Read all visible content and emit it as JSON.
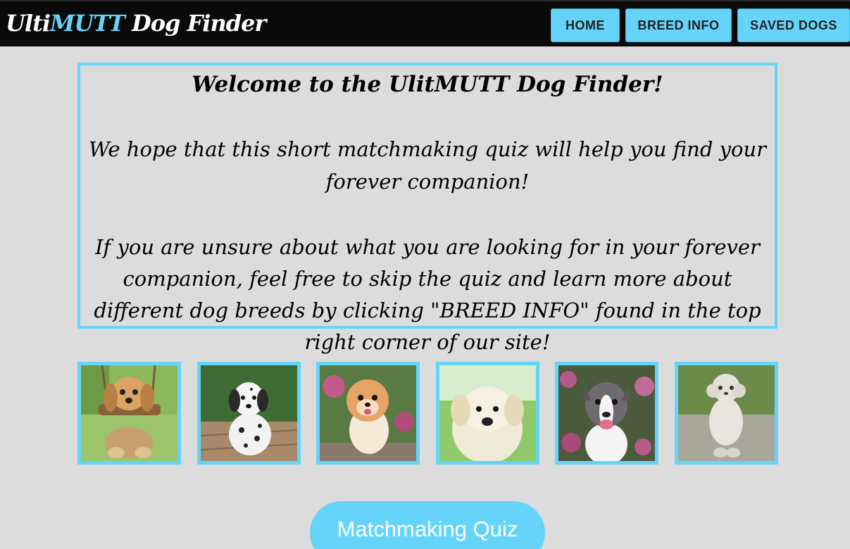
{
  "header": {
    "brand_prefix": "Ulti",
    "brand_accent": "MUTT",
    "brand_suffix": " Dog Finder",
    "nav": {
      "home": "HOME",
      "breed_info": "BREED INFO",
      "saved_dogs": "SAVED DOGS"
    }
  },
  "welcome": {
    "title": "Welcome to the UlitMUTT Dog Finder!",
    "paragraph_1": "We hope that this short matchmaking quiz will help you find your forever companion!",
    "paragraph_2": "If you are unsure about what you are looking for in your forever companion, feel free to skip the quiz and learn more about different dog breeds by clicking \"BREED INFO\" found in the top right corner of our site!"
  },
  "gallery": {
    "images": [
      "puppy-on-swing-image",
      "dalmatian-puppy-image",
      "pomeranian-image",
      "white-puppy-image",
      "pit-bull-image",
      "poodle-statue-image"
    ]
  },
  "quiz_button": {
    "label": "Matchmaking Quiz"
  },
  "colors": {
    "accent": "#66d4f9",
    "header_bg": "#0a0a0a",
    "page_bg": "#dcdcdc"
  }
}
